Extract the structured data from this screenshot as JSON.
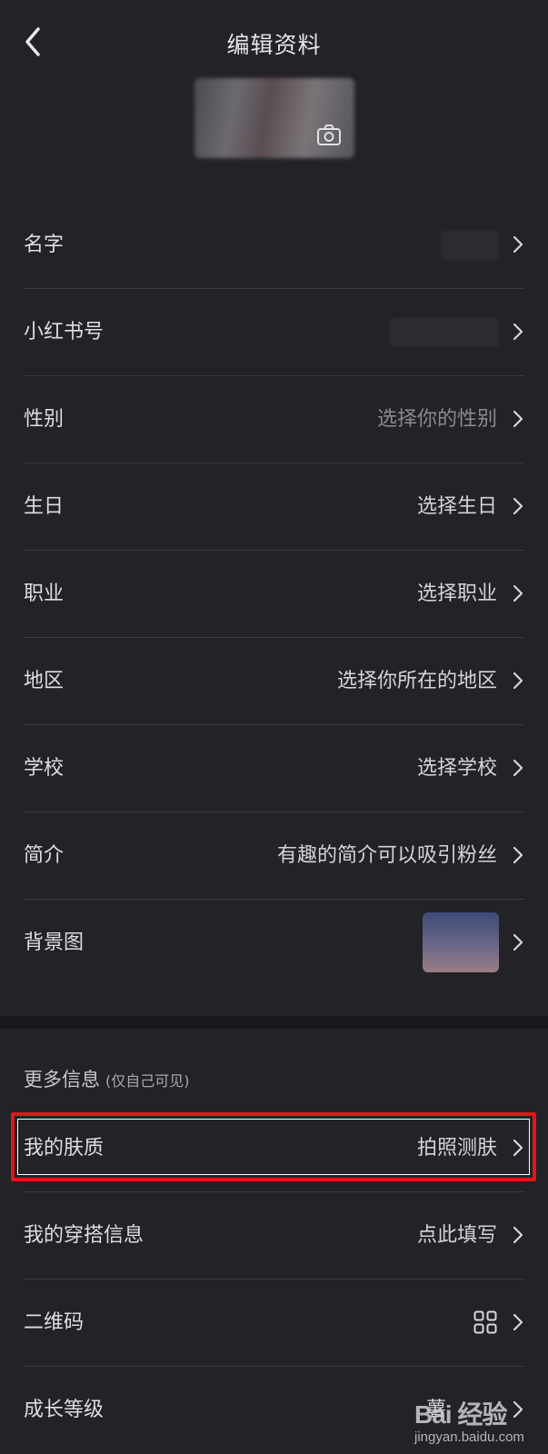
{
  "header": {
    "title": "编辑资料"
  },
  "profile_rows": [
    {
      "label": "名字",
      "value": ""
    },
    {
      "label": "小红书号",
      "value": ""
    },
    {
      "label": "性别",
      "value": "选择你的性别"
    },
    {
      "label": "生日",
      "value": "选择生日"
    },
    {
      "label": "职业",
      "value": "选择职业"
    },
    {
      "label": "地区",
      "value": "选择你所在的地区"
    },
    {
      "label": "学校",
      "value": "选择学校"
    },
    {
      "label": "简介",
      "value": "有趣的简介可以吸引粉丝"
    },
    {
      "label": "背景图",
      "value": ""
    }
  ],
  "more_info": {
    "title": "更多信息",
    "subtitle": "(仅自己可见)"
  },
  "more_rows": [
    {
      "label": "我的肤质",
      "value": "拍照测肤"
    },
    {
      "label": "我的穿搭信息",
      "value": "点此填写"
    },
    {
      "label": "二维码",
      "value": ""
    },
    {
      "label": "成长等级",
      "value": "薯"
    }
  ],
  "watermark": {
    "logo": "Bai 经验",
    "url": "jingyan.baidu.com"
  },
  "colors": {
    "background": "#232227",
    "highlight_border": "#e01818",
    "muted_text": "#8a8a90"
  },
  "icons": {
    "back": "back-icon",
    "camera": "camera-icon",
    "chevron": "chevron-right-icon",
    "qr": "qr-code-icon"
  }
}
